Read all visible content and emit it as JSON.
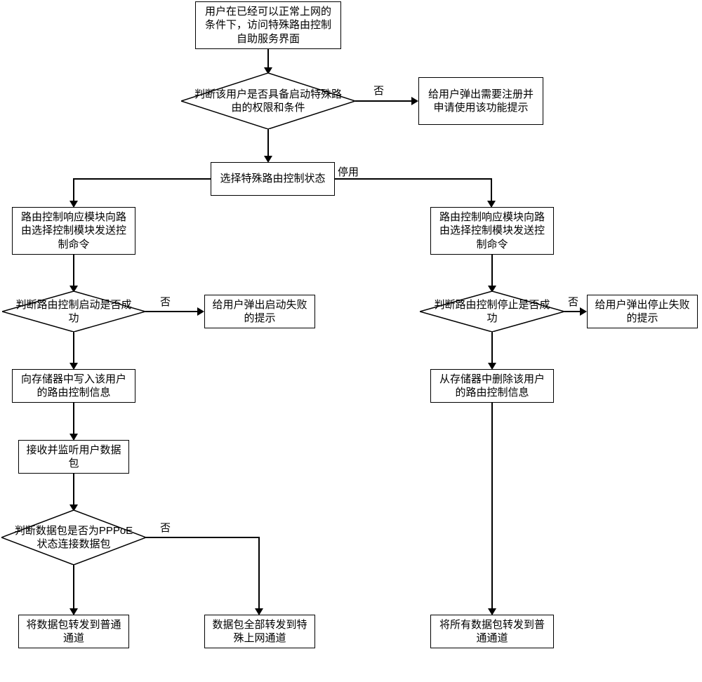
{
  "nodes": {
    "start": "用户在已经可以正常上网的条件下，访问特殊路由控制自助服务界面",
    "check_perm": "判断该用户是否具备启动特殊路由的权限和条件",
    "need_register": "给用户弹出需要注册并申请使用该功能提示",
    "select_state": "选择特殊路由控制状态",
    "left_send": "路由控制响应模块向路由选择控制模块发送控制命令",
    "right_send": "路由控制响应模块向路由选择控制模块发送控制命令",
    "check_start": "判断路由控制启动是否成功",
    "start_fail": "给用户弹出启动失败的提示",
    "check_stop": "判断路由控制停止是否成功",
    "stop_fail": "给用户弹出停止失败的提示",
    "write_store": "向存储器中写入该用户的路由控制信息",
    "delete_store": "从存储器中删除该用户的路由控制信息",
    "listen": "接收并监听用户数据包",
    "check_pppoe": "判断数据包是否为PPPoE状态连接数据包",
    "fwd_normal": "将数据包转发到普通通道",
    "fwd_special": "数据包全部转发到特殊上网通道",
    "fwd_all_normal": "将所有数据包转发到普通通道"
  },
  "labels": {
    "no": "否",
    "disable": "停用"
  }
}
